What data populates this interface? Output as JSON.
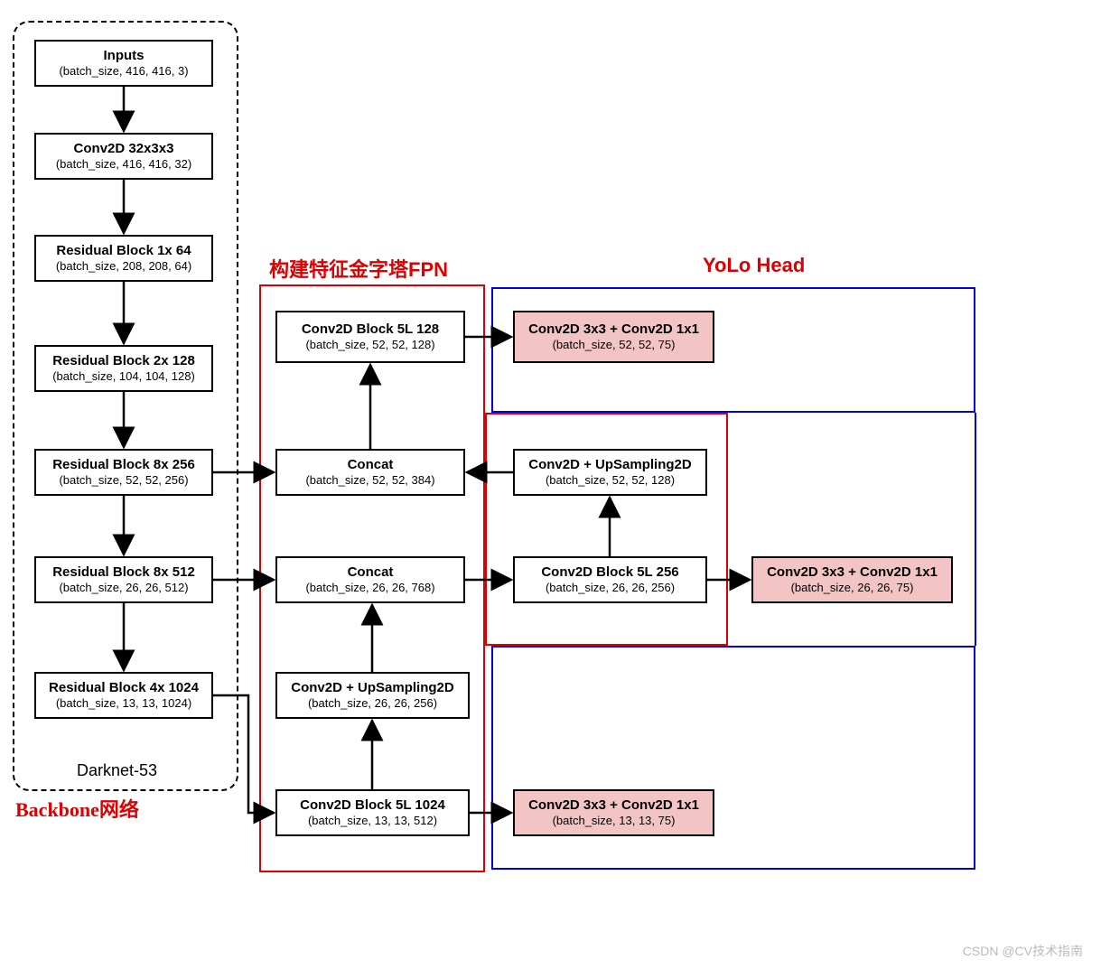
{
  "sections": {
    "backbone_label": "Backbone网络",
    "darknet_label": "Darknet-53",
    "fpn_label": "构建特征金字塔FPN",
    "head_label": "YoLo Head"
  },
  "backbone": {
    "inputs": {
      "title": "Inputs",
      "shape": "(batch_size, 416, 416, 3)"
    },
    "conv0": {
      "title": "Conv2D 32x3x3",
      "shape": "(batch_size, 416, 416, 32)"
    },
    "res1": {
      "title": "Residual Block 1x  64",
      "shape": "(batch_size, 208, 208, 64)"
    },
    "res2": {
      "title": "Residual Block 2x  128",
      "shape": "(batch_size, 104, 104, 128)"
    },
    "res3": {
      "title": "Residual Block 8x  256",
      "shape": "(batch_size, 52, 52, 256)"
    },
    "res4": {
      "title": "Residual Block 8x  512",
      "shape": "(batch_size, 26, 26, 512)"
    },
    "res5": {
      "title": "Residual Block 4x  1024",
      "shape": "(batch_size, 13, 13, 1024)"
    }
  },
  "fpn": {
    "block5l_128": {
      "title": "Conv2D Block 5L  128",
      "shape": "(batch_size, 52, 52, 128)"
    },
    "concat_384": {
      "title": "Concat",
      "shape": "(batch_size, 52, 52, 384)"
    },
    "upsamp_128": {
      "title": "Conv2D + UpSampling2D",
      "shape": "(batch_size, 52, 52, 128)"
    },
    "concat_768": {
      "title": "Concat",
      "shape": "(batch_size, 26, 26, 768)"
    },
    "block5l_256": {
      "title": "Conv2D Block 5L  256",
      "shape": "(batch_size, 26, 26, 256)"
    },
    "upsamp_256": {
      "title": "Conv2D + UpSampling2D",
      "shape": "(batch_size, 26, 26, 256)"
    },
    "block5l_1024": {
      "title": "Conv2D Block 5L  1024",
      "shape": "(batch_size, 13, 13, 512)"
    }
  },
  "head": {
    "out52": {
      "title": "Conv2D 3x3 + Conv2D 1x1",
      "shape": "(batch_size, 52, 52, 75)"
    },
    "out26": {
      "title": "Conv2D 3x3 + Conv2D 1x1",
      "shape": "(batch_size, 26, 26, 75)"
    },
    "out13": {
      "title": "Conv2D 3x3 + Conv2D 1x1",
      "shape": "(batch_size, 13, 13, 75)"
    }
  },
  "watermark": "CSDN @CV技术指南"
}
